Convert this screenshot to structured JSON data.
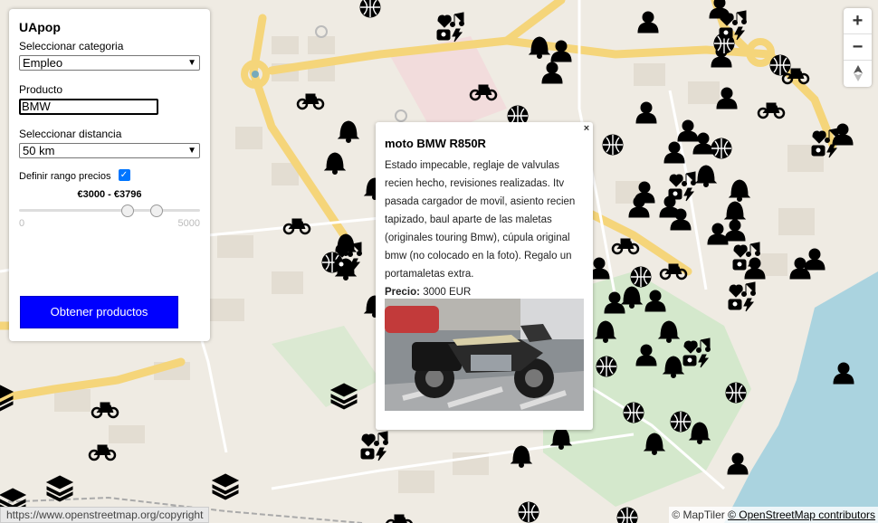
{
  "app": {
    "title": "UApop"
  },
  "filters": {
    "category_label": "Seleccionar categoria",
    "category_value": "Empleo",
    "product_label": "Producto",
    "product_value": "BMW",
    "distance_label": "Seleccionar distancia",
    "distance_value": "50 km",
    "price_range_label": "Definir rango precios",
    "price_range_checked": true,
    "price_range_text": "€3000  - €3796",
    "slider_min": "0",
    "slider_max": "5000",
    "slider_low": 3000,
    "slider_high": 3796,
    "submit_label": "Obtener productos"
  },
  "zoom": {
    "in": "+",
    "out": "−",
    "reset": "reset-north-icon"
  },
  "popup": {
    "close": "×",
    "title": "moto BMW R850R",
    "description": "Estado impecable, reglaje de valvulas recien hecho, revisiones realizadas. Itv pasada cargador de movil, asiento recien tapizado, baul aparte de las maletas (originales touring Bmw), cúpula original bmw (no colocado en la foto). Regalo un portamaletas extra.",
    "price_label": "Precio:",
    "price_value": "3000 EUR"
  },
  "attribution": {
    "maptiler": "© MapTiler",
    "osm": "© OpenStreetMap contributors"
  },
  "status_url": "https://www.openstreetmap.org/copyright",
  "colors": {
    "button": "#0000ff",
    "road": "#f7d983",
    "water": "#aad3df",
    "park": "#c8e6c4"
  }
}
